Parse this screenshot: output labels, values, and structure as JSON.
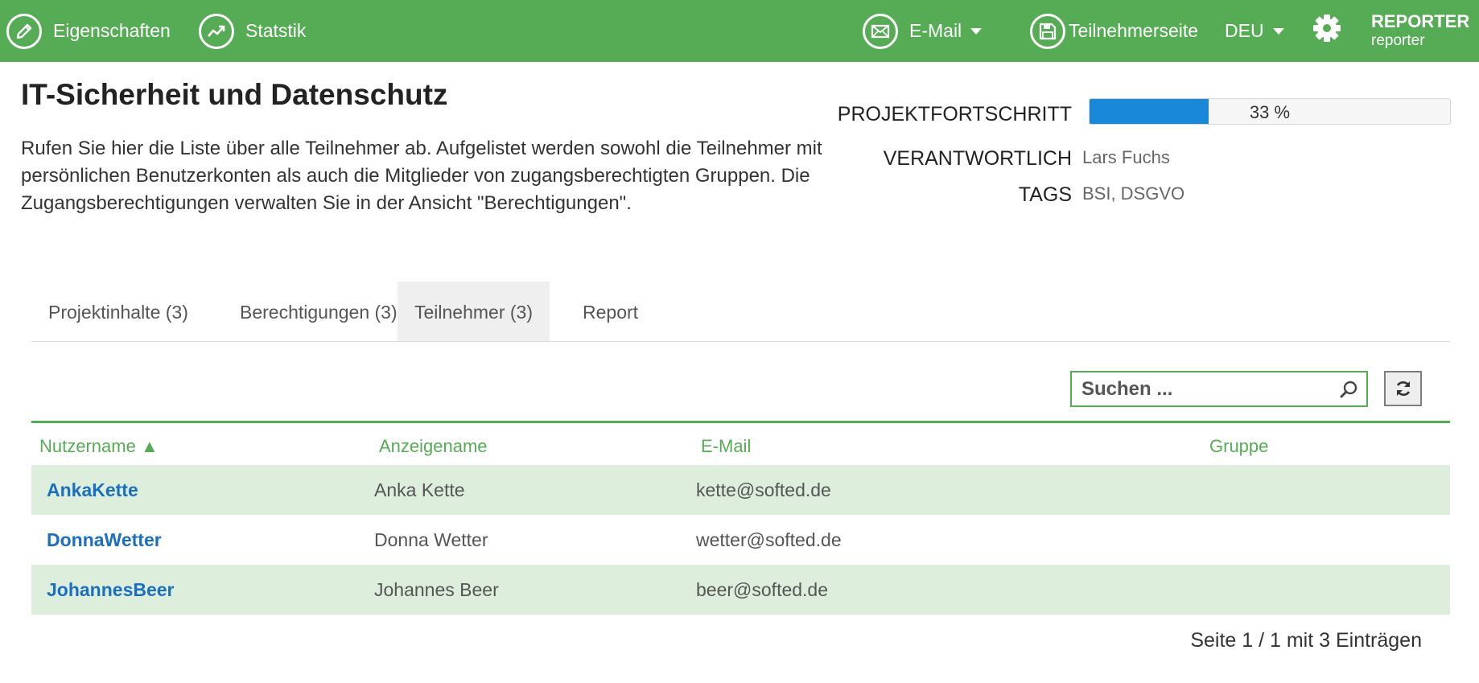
{
  "header": {
    "nav": [
      {
        "label": "Eigenschaften",
        "icon": "pencil-icon"
      },
      {
        "label": "Statstik",
        "icon": "trend-up-icon"
      }
    ],
    "email_label": "E-Mail",
    "participant_page_label": "Teilnehmerseite",
    "language": "DEU",
    "user_name": "REPORTER",
    "user_role": "reporter"
  },
  "project": {
    "title": "IT-Sicherheit und Datenschutz",
    "description": "Rufen Sie hier die Liste über alle Teilnehmer ab. Aufgelistet werden sowohl die Teilnehmer mit persönlichen Benutzerkonten als auch die Mitglieder von zugangsberechtigten Gruppen. Die Zugangsberechtigungen verwalten Sie in der Ansicht \"Berechtigungen\".",
    "progress_label": "PROJEKTFORTSCHRITT",
    "progress_percent": 33,
    "progress_text": "33 %",
    "responsible_label": "VERANTWORTLICH",
    "responsible_value": "Lars Fuchs",
    "tags_label": "TAGS",
    "tags_value": "BSI, DSGVO"
  },
  "tabs": [
    {
      "label": "Projektinhalte (3)",
      "active": false
    },
    {
      "label": "Berechtigungen (3)",
      "active": false
    },
    {
      "label": "Teilnehmer (3)",
      "active": true
    },
    {
      "label": "Report",
      "active": false
    }
  ],
  "search": {
    "placeholder": "Suchen ..."
  },
  "table": {
    "columns": [
      "Nutzername ▲",
      "Anzeigename",
      "E-Mail",
      "Gruppe"
    ],
    "rows": [
      {
        "username": "AnkaKette",
        "display_name": "Anka Kette",
        "email": "kette@softed.de",
        "group": ""
      },
      {
        "username": "DonnaWetter",
        "display_name": "Donna Wetter",
        "email": "wetter@softed.de",
        "group": ""
      },
      {
        "username": "JohannesBeer",
        "display_name": "Johannes Beer",
        "email": "beer@softed.de",
        "group": ""
      }
    ]
  },
  "pager": {
    "text": "Seite 1 / 1 mit 3 Einträgen"
  },
  "colors": {
    "brand_green": "#55ac55",
    "link_blue": "#1a6fc0",
    "progress_blue": "#1a88d8",
    "row_stripe": "#ddeedd"
  }
}
